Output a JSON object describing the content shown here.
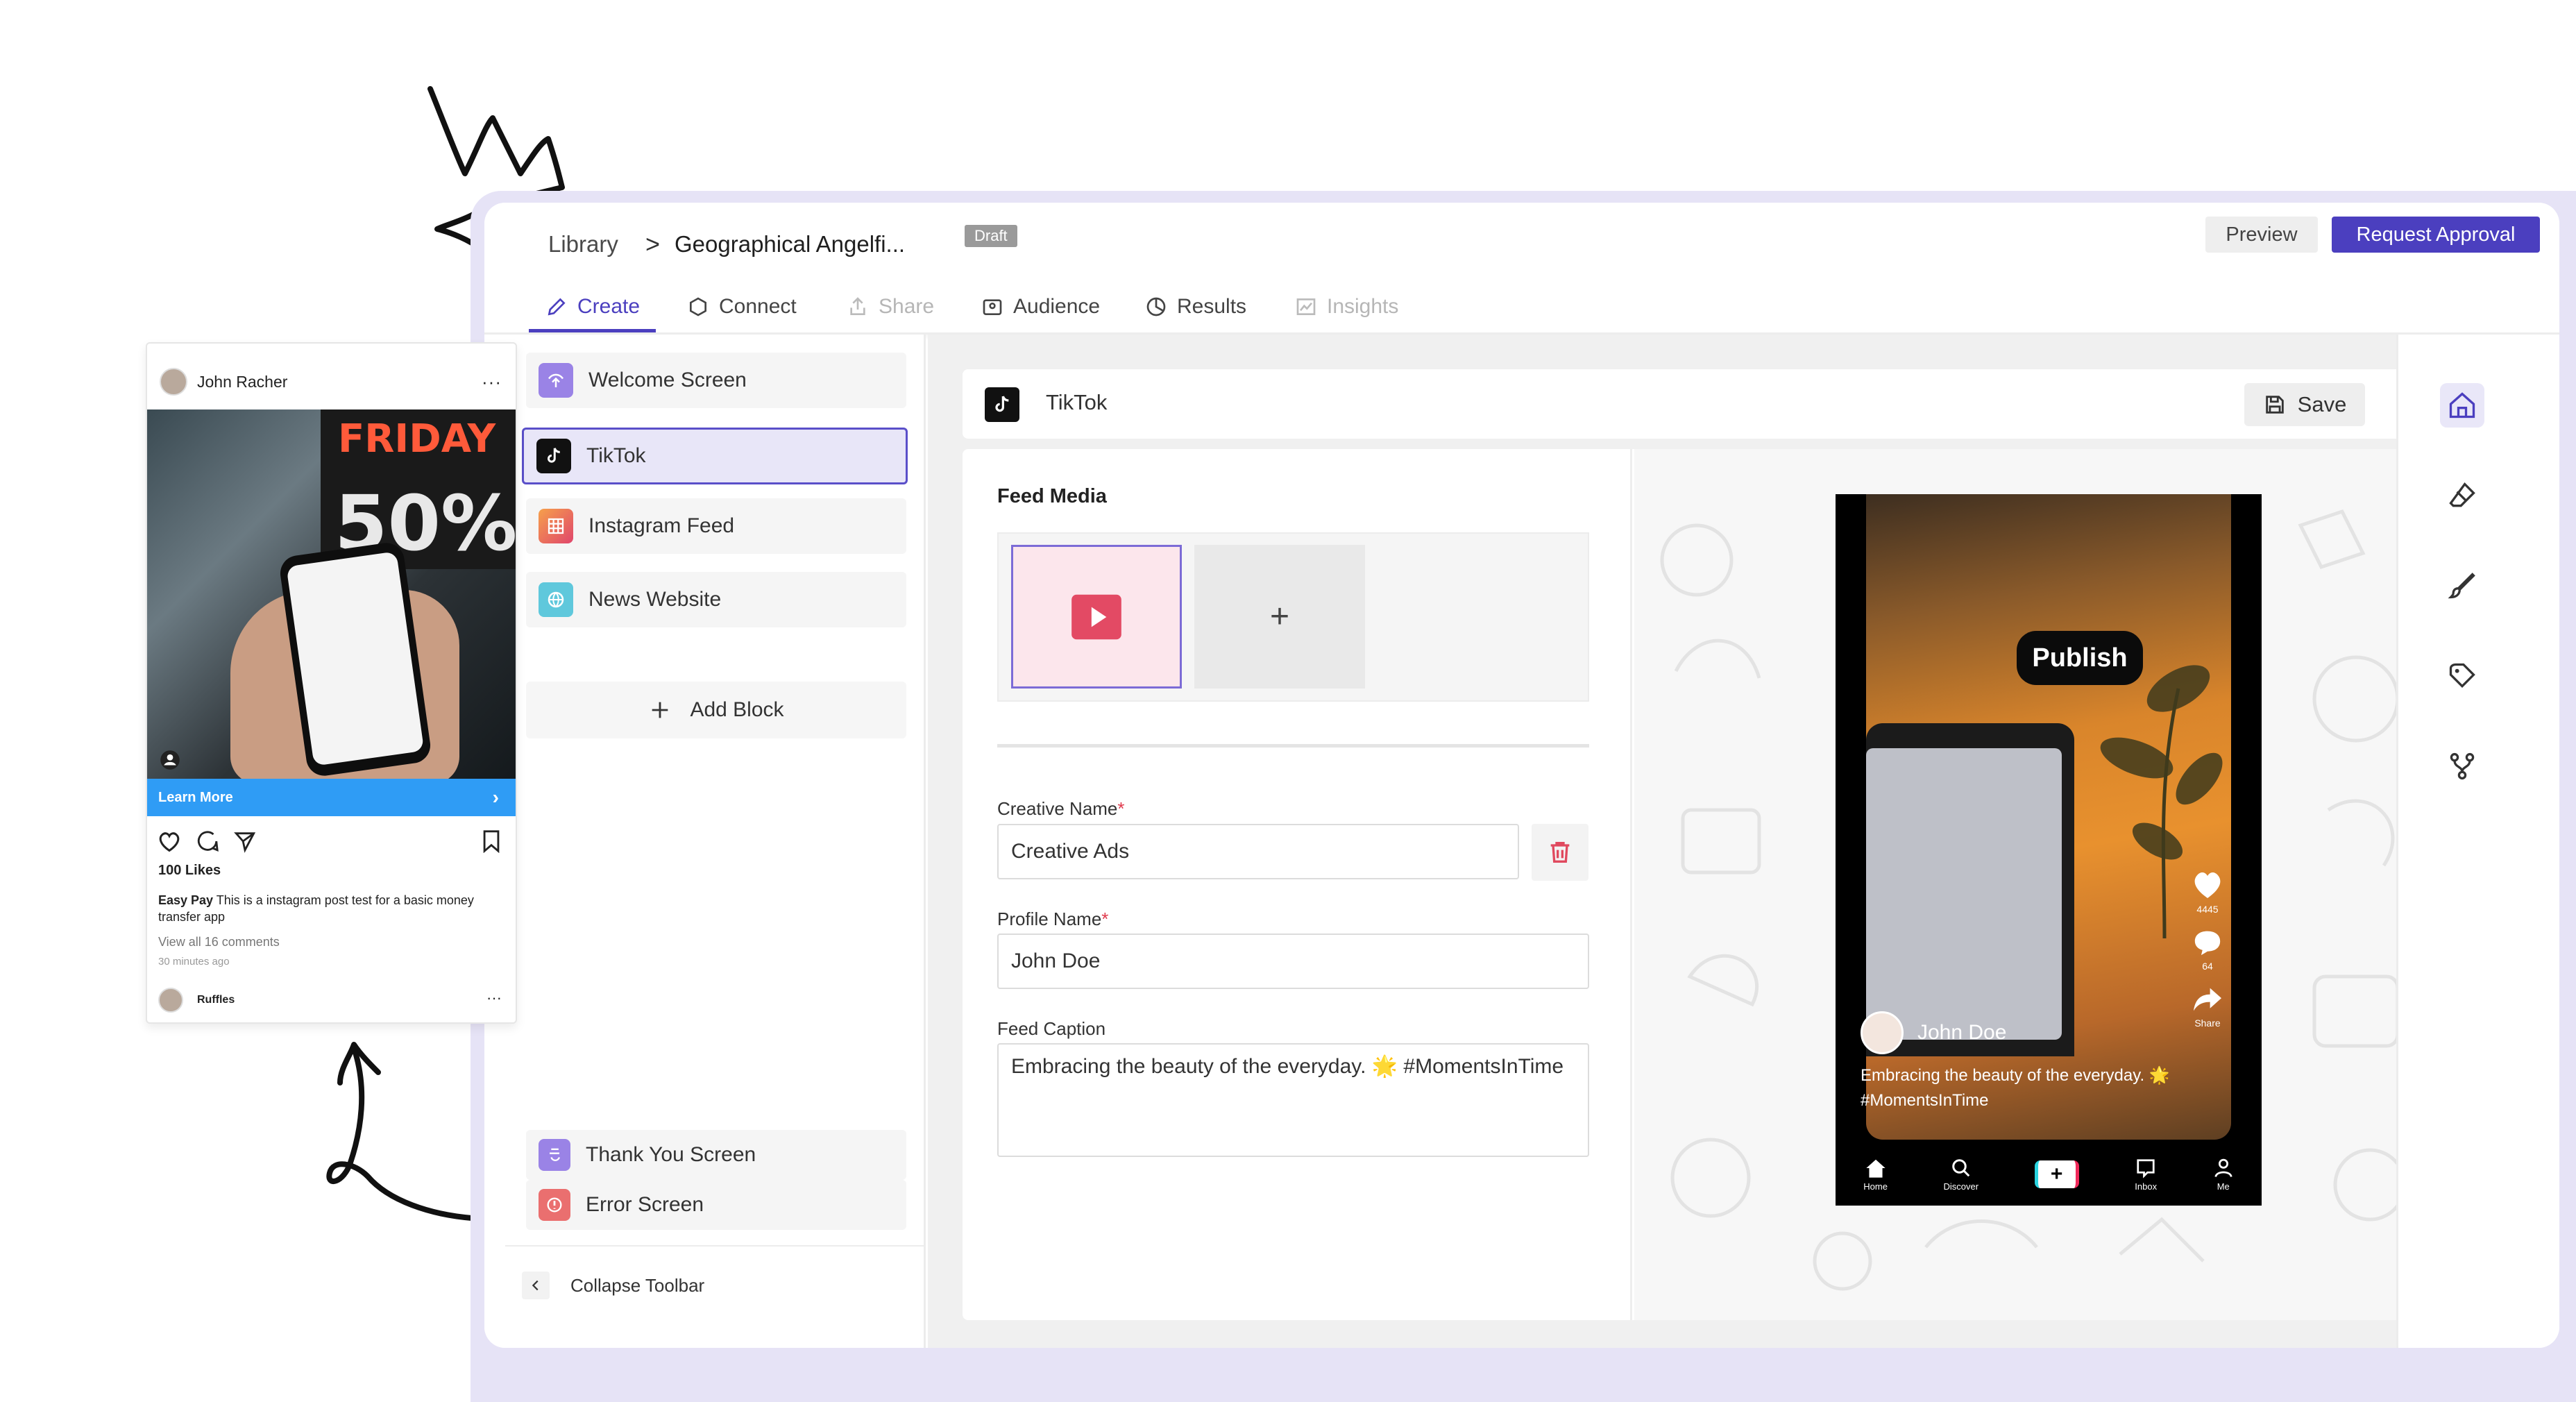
{
  "breadcrumb": {
    "library": "Library",
    "separator": ">",
    "title": "Geographical Angelfi...",
    "status": "Draft"
  },
  "header_actions": {
    "preview": "Preview",
    "request_approval": "Request Approval"
  },
  "tabs": [
    {
      "label": "Create",
      "icon": "pencil-icon",
      "state": "active"
    },
    {
      "label": "Connect",
      "icon": "hexagon-icon",
      "state": "normal"
    },
    {
      "label": "Share",
      "icon": "share-icon",
      "state": "disabled"
    },
    {
      "label": "Audience",
      "icon": "audience-icon",
      "state": "normal"
    },
    {
      "label": "Results",
      "icon": "pie-chart-icon",
      "state": "normal"
    },
    {
      "label": "Insights",
      "icon": "line-chart-icon",
      "state": "disabled"
    }
  ],
  "sidebar": {
    "items": [
      {
        "label": "Welcome Screen",
        "icon": "welcome-icon",
        "active": false
      },
      {
        "label": "TikTok",
        "icon": "tiktok-icon",
        "active": true
      },
      {
        "label": "Instagram Feed",
        "icon": "grid-icon",
        "active": false
      },
      {
        "label": "News Website",
        "icon": "globe-icon",
        "active": false
      }
    ],
    "add_block": "Add Block",
    "bottom_items": [
      {
        "label": "Thank You Screen",
        "icon": "thank-you-icon"
      },
      {
        "label": "Error Screen",
        "icon": "error-icon"
      }
    ],
    "collapse": "Collapse Toolbar"
  },
  "editor": {
    "platform": "TikTok",
    "save": "Save",
    "feed_media": "Feed Media",
    "media_add": "+",
    "creative_name_label": "Creative Name",
    "creative_name_value": "Creative Ads",
    "profile_name_label": "Profile Name",
    "profile_name_value": "John Doe",
    "feed_caption_label": "Feed Caption",
    "feed_caption_value": "Embracing the beauty of the everyday. 🌟 #MomentsInTime",
    "required_mark": "*"
  },
  "phone_preview": {
    "publish": "Publish",
    "user": "John Doe",
    "caption": "Embracing the beauty of the everyday. 🌟 #MomentsInTime",
    "likes": "4445",
    "comments": "64",
    "share": "Share",
    "nav": [
      "Home",
      "Discover",
      "+",
      "Inbox",
      "Me"
    ]
  },
  "instagram_card": {
    "user": "John Racher",
    "dots": "···",
    "sign_top": "FRIDAY",
    "sign_big": "50%",
    "cta": "Learn More",
    "likes": "100 Likes",
    "caption_user": "Easy Pay",
    "caption_text": " This is a instagram post test for a basic money transfer app",
    "comments": "View all 16 comments",
    "time": "30 minutes ago",
    "commenter": "Ruffles"
  },
  "colors": {
    "accent": "#4b3fbf",
    "required": "#e03a4d",
    "ig_cta": "#2f9cf5",
    "frame": "#e6e3f6"
  }
}
